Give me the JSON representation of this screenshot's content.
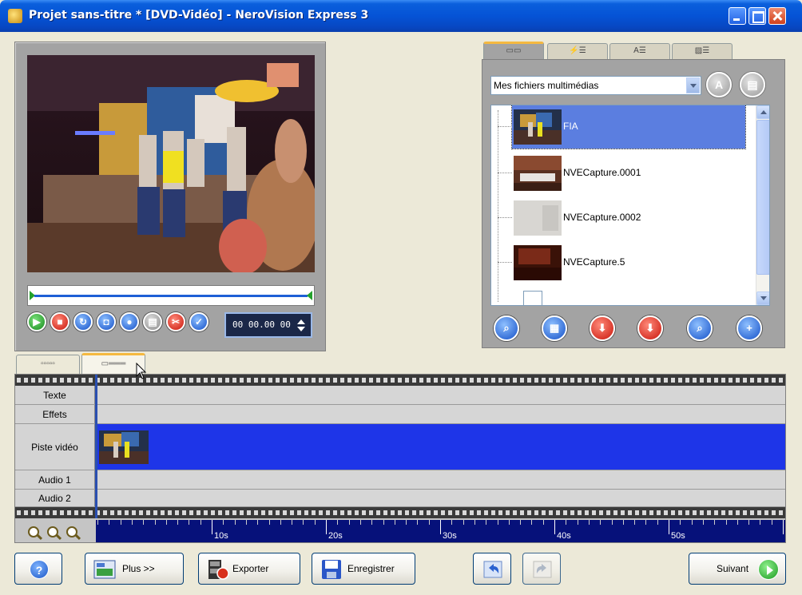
{
  "window": {
    "title": "Projet sans-titre * [DVD-Vidéo] - NeroVision Express 3"
  },
  "preview": {
    "timecode": "00 00.00 00",
    "controls": [
      "play-icon",
      "stop-icon",
      "loop-icon",
      "snapshot-icon",
      "record-icon",
      "chapter-icon",
      "cut-icon",
      "confirm-icon"
    ]
  },
  "media": {
    "tabs": [
      "video-tab-icon",
      "effects-tab-icon",
      "text-tab-icon",
      "transitions-tab-icon"
    ],
    "source_select": "Mes fichiers multimédias",
    "items": [
      {
        "label": "FIA",
        "selected": true
      },
      {
        "label": "NVECapture.0001",
        "selected": false
      },
      {
        "label": "NVECapture.0002",
        "selected": false
      },
      {
        "label": "NVECapture.5",
        "selected": false
      }
    ],
    "actions": [
      "search-icon",
      "filmstrip-icon",
      "import-icon",
      "capture-icon",
      "browse-icon",
      "add-icon"
    ]
  },
  "timeline": {
    "tracks": {
      "text": "Texte",
      "effects": "Effets",
      "video": "Piste vidéo",
      "audio1": "Audio 1",
      "audio2": "Audio 2"
    },
    "ruler": [
      "10s",
      "20s",
      "30s",
      "40s",
      "50s"
    ]
  },
  "buttons": {
    "more": "Plus >>",
    "export": "Exporter",
    "save": "Enregistrer",
    "next": "Suivant"
  },
  "colors": {
    "titlebar": "#0553d6",
    "video_track": "#1e35e8",
    "ruler": "#06117a",
    "selection": "#5b7ee0"
  }
}
